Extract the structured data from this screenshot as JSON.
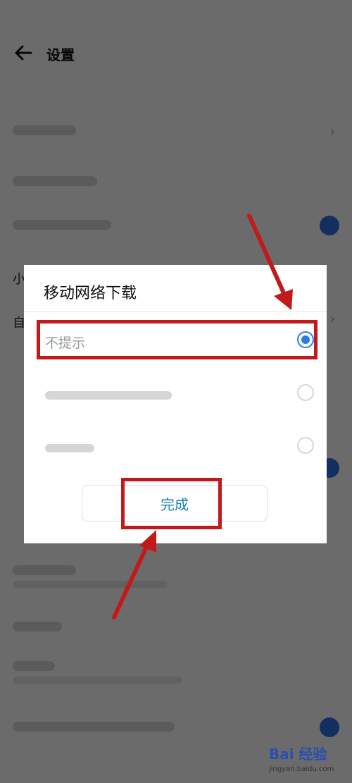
{
  "header": {
    "title": "设置"
  },
  "background": {
    "partial_labels": [
      "小",
      "自"
    ]
  },
  "dialog": {
    "title": "移动网络下载",
    "options": [
      {
        "label": "不提示",
        "selected": true
      },
      {
        "label": "",
        "selected": false
      },
      {
        "label": "",
        "selected": false
      }
    ],
    "done_label": "完成"
  },
  "colors": {
    "accent": "#2a7bea",
    "annotation": "#c21a1a",
    "button_text": "#1a7fb6"
  },
  "watermark": {
    "brand": "Bai 经验",
    "url": "jingyan.baidu.com"
  }
}
